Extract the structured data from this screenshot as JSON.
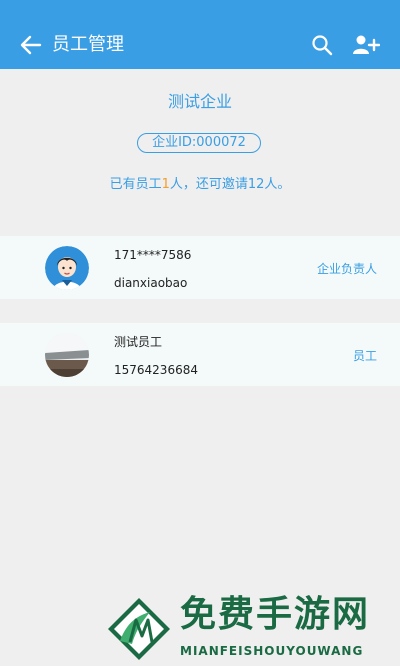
{
  "appbar": {
    "title": "员工管理",
    "icons": [
      "arrow-back-icon",
      "search-icon",
      "add-user-icon"
    ],
    "color": "#3a9ee4"
  },
  "company": {
    "name": "测试企业",
    "id_label": "企业ID:000072",
    "summary_prefix": "已有员工",
    "summary_count": "1",
    "summary_suffix": "人，还可邀请12人。"
  },
  "members": [
    {
      "line1": "171****7586",
      "line2": "dianxiaobao",
      "role": "企业负责人",
      "avatar": "cartoon-avatar"
    },
    {
      "line1": "测试员工",
      "line2": "15764236684",
      "role": "员工",
      "avatar": "photo-avatar"
    }
  ],
  "watermark": {
    "title": "免费手游网",
    "subtitle": "MIANFEISHOUYOUWANG"
  },
  "colors": {
    "accent": "#3a9ee4",
    "highlight": "#f0a030",
    "row_background": "#f3faf9",
    "page_background": "#efefef"
  }
}
